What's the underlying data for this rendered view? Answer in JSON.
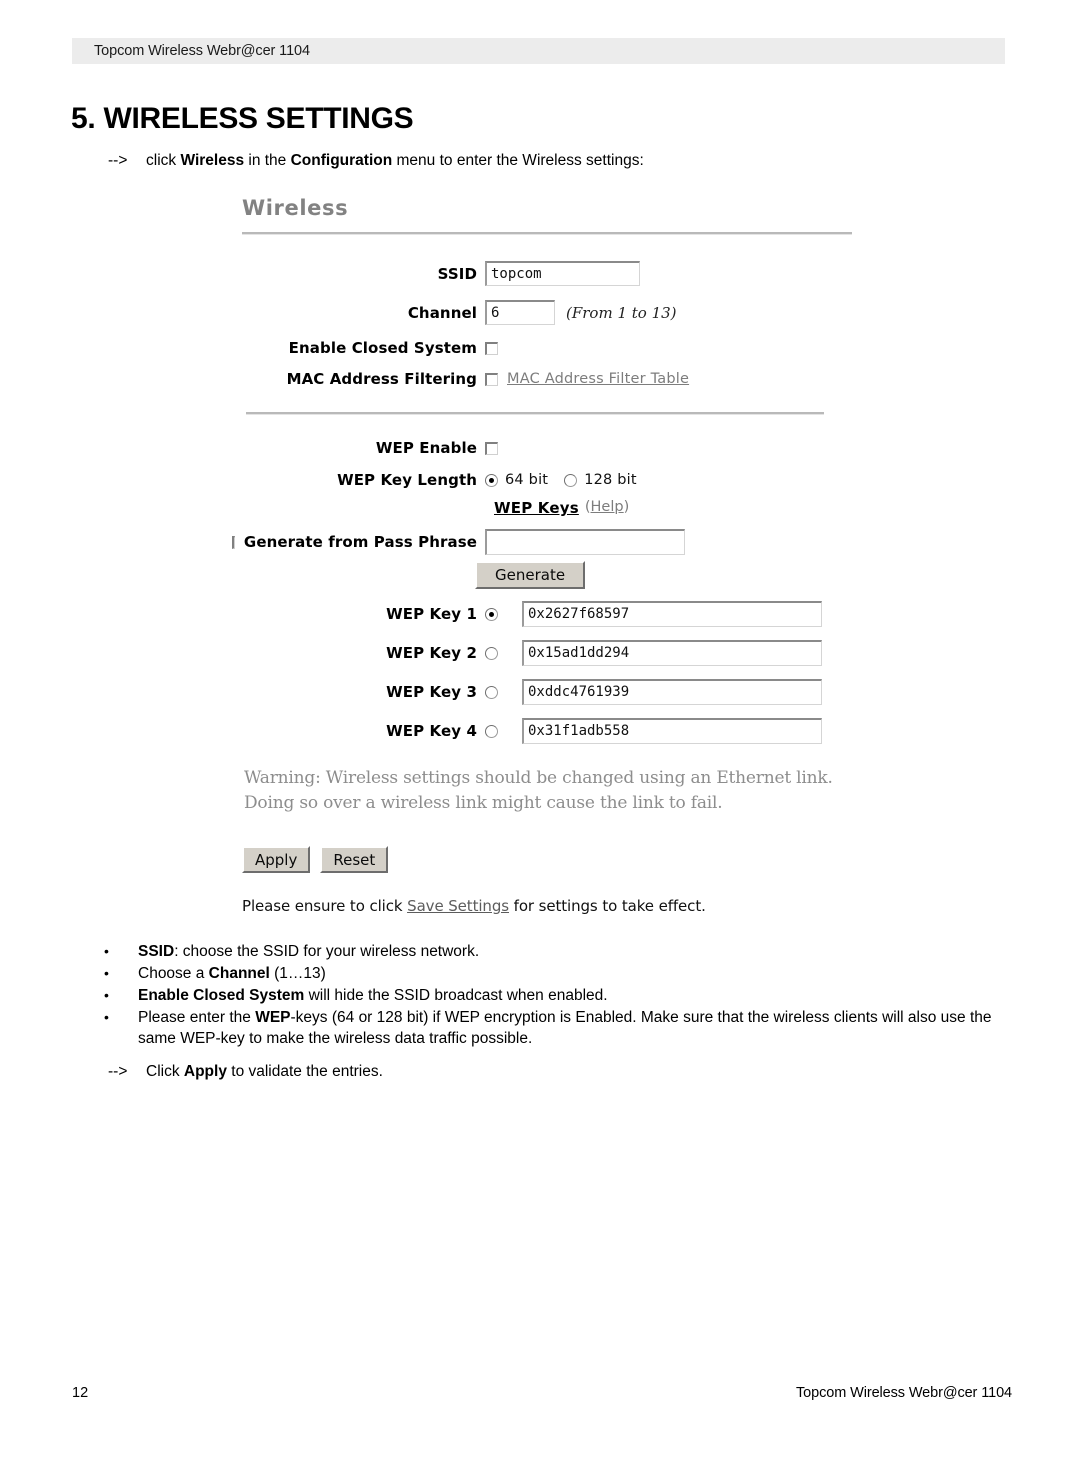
{
  "document": {
    "running_header": "Topcom Wireless Webr@cer 1104",
    "chapter_title": "5. WIRELESS SETTINGS",
    "intro": {
      "arrow": "-->",
      "part1": "click ",
      "bold1": "Wireless",
      "part2": " in the ",
      "bold2": "Configuration",
      "part3": " menu to enter the Wireless settings:"
    },
    "footer": {
      "page_number": "12",
      "doc_name": "Topcom Wireless Webr@cer 1104"
    }
  },
  "panel": {
    "title": "Wireless",
    "ssid": {
      "label": "SSID",
      "value": "topcom"
    },
    "channel": {
      "label": "Channel",
      "value": "6",
      "hint": "(From 1 to 13)"
    },
    "closed_system": {
      "label": "Enable Closed System",
      "checked": false
    },
    "mac_filtering": {
      "label": "MAC Address Filtering",
      "checked": false,
      "link": "MAC Address Filter Table"
    },
    "wep_enable": {
      "label": "WEP Enable",
      "checked": false
    },
    "wep_key_length": {
      "label": "WEP Key Length",
      "option_64": "64 bit",
      "option_128": "128 bit",
      "selected": "64 bit"
    },
    "wep_keys_heading": {
      "title": "WEP Keys",
      "help_open": "(",
      "help": "Help",
      "help_close": ")"
    },
    "pass_phrase": {
      "label": "Generate from Pass Phrase",
      "checked": false,
      "value": "",
      "generate_button": "Generate"
    },
    "wep_keys": [
      {
        "label": "WEP Key 1",
        "value": "0x2627f68597",
        "selected": true
      },
      {
        "label": "WEP Key 2",
        "value": "0x15ad1dd294",
        "selected": false
      },
      {
        "label": "WEP Key 3",
        "value": "0xddc4761939",
        "selected": false
      },
      {
        "label": "WEP Key 4",
        "value": "0x31f1adb558",
        "selected": false
      }
    ],
    "warning": {
      "line1": "Warning: Wireless settings should be changed using an Ethernet link.",
      "line2": "Doing so over a wireless link might cause the link to fail."
    },
    "buttons": {
      "apply": "Apply",
      "reset": "Reset"
    },
    "ensure": {
      "part1": "Please ensure to click ",
      "link": "Save Settings",
      "part2": " for settings to take effect."
    },
    "colors": {
      "panel_title": "#828282",
      "warning_text": "#8d8d8d",
      "link": "#7d7d7d",
      "header_bar": "#ececec",
      "button_face": "#d4d0c8"
    }
  },
  "notes": {
    "bullet_char": "•",
    "items": [
      {
        "bold": "SSID",
        "rest": ": choose the SSID for your wireless network."
      },
      {
        "pre": "Choose a ",
        "bold": "Channel",
        "rest": " (1…13)"
      },
      {
        "bold": "Enable Closed System",
        "rest": " will hide the SSID broadcast when enabled."
      },
      {
        "pre": "Please enter the ",
        "bold": "WEP",
        "rest": "-keys (64 or 128 bit) if WEP encryption is Enabled. Make sure that the wireless clients will also use the same WEP-key to make the wireless data traffic possible."
      }
    ],
    "closing": {
      "arrow": "-->",
      "pre": "Click ",
      "bold": "Apply",
      "rest": " to validate the entries."
    }
  }
}
